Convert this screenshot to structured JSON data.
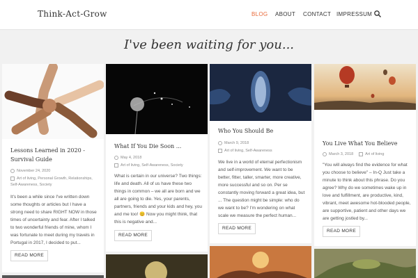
{
  "site": {
    "logo": "Think-Act-Grow",
    "tagline": "I've been waiting for you..."
  },
  "nav": [
    {
      "label": "BLOG",
      "active": true
    },
    {
      "label": "ABOUT"
    },
    {
      "label": "CONTACT"
    },
    {
      "label": "IMPRESSUM"
    }
  ],
  "posts": [
    {
      "title": "Lessons Learned in 2020 - Survival Guide",
      "date": "November 24, 2020",
      "categories": "Art of living, Personal Growth, Relationships, Self-Awareness, Society",
      "excerpt": "It's been a while since I've written down some thoughts or articles but I have a strong need to share RIGHT NOW in those times of uncertainty and fear. After I talked to two wonderful friends of mine, whom I was fortunate to meet during my travels in Portugal in 2017, I decided to put...",
      "button": "READ MORE"
    },
    {
      "title": "What If You Die Soon ...",
      "date": "May 4, 2018",
      "categories": "Art of living, Self-Awareness, Society",
      "excerpt": "What is certain in our universe? Two things: life and death. All of us have these two things in common –  we all are born and we all are going to die. Yes, your parents, partners, friends and your kids and hey, you and me too! 😊 Now you might think, that this is negative and...",
      "button": "READ MORE"
    },
    {
      "title": "Who You Should Be",
      "date": "March 9, 2018",
      "categories": "Art of living, Self-Awareness",
      "excerpt": "We live in a world of eternal perfectionism and self-improvement. We want to be better, fitter, taller, smarter, more creative, more successful and so on. Per se constantly moving forward a great idea, but ... The question might be simple: who do we want to be? I'm wondering on what scale we measure the perfect human...",
      "button": "READ MORE"
    },
    {
      "title": "You Live What You Believe",
      "date": "March 3, 2018",
      "categories": "Art of living",
      "excerpt": "\"You will always find the evidence for what you choose to believe\" – In-Q Just take a minute to think about this phrase. Do you agree? Why do we sometimes wake up in love and fulfillment, are productive, kind, vibrant, meet awesome hot-blooded people, are supportive, patient and other days we are getting jostled by...",
      "button": "READ MORE"
    }
  ],
  "colors": {
    "accent": "#e86a3a",
    "background": "#f1f1f1"
  }
}
